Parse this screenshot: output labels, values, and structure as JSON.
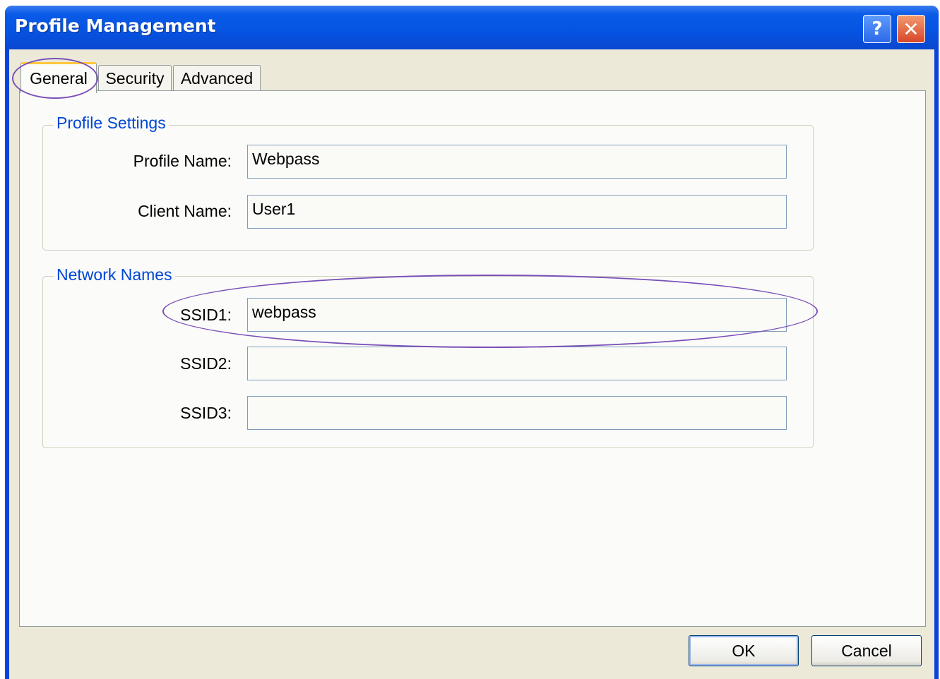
{
  "window": {
    "title": "Profile Management",
    "help_label": "?",
    "close_label": "✕"
  },
  "tabs": [
    {
      "label": "General",
      "active": true
    },
    {
      "label": "Security",
      "active": false
    },
    {
      "label": "Advanced",
      "active": false
    }
  ],
  "profile_settings": {
    "group_title": "Profile Settings",
    "profile_name_label": "Profile Name:",
    "profile_name_value": "Webpass",
    "client_name_label": "Client Name:",
    "client_name_value": "User1"
  },
  "network_names": {
    "group_title": "Network Names",
    "ssid1_label": "SSID1:",
    "ssid1_value": "webpass",
    "ssid2_label": "SSID2:",
    "ssid2_value": "",
    "ssid3_label": "SSID3:",
    "ssid3_value": ""
  },
  "buttons": {
    "ok_label": "OK",
    "cancel_label": "Cancel"
  },
  "colors": {
    "titlebar": "#0553e1",
    "group_title": "#0046d5",
    "highlight_ellipse": "#7a50b8"
  }
}
